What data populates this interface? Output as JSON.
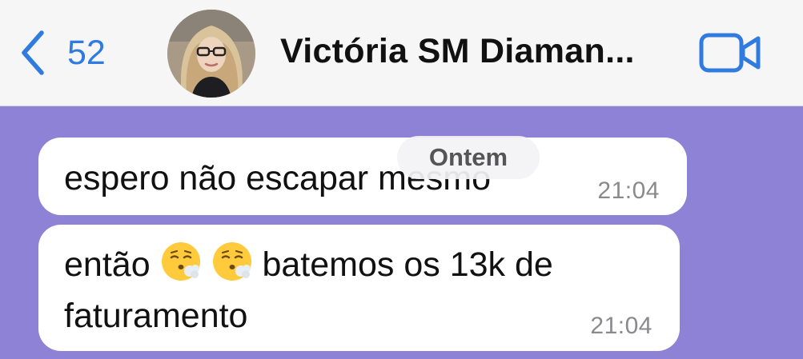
{
  "header": {
    "back_count": "52",
    "contact_name": "Victória SM Diaman...",
    "accent_color": "#2F7BE0",
    "icons": {
      "back": "chevron-left-icon",
      "video": "video-camera-icon"
    }
  },
  "date_separator": "Ontem",
  "messages": [
    {
      "text": "espero não escapar mesmo",
      "time": "21:04"
    },
    {
      "text_line1_before": "então",
      "text_line1_after": "batemos os 13k de",
      "text_line2": "faturamento",
      "emojis": [
        "face-exhaling-emoji",
        "face-exhaling-emoji"
      ],
      "time": "21:04"
    }
  ],
  "colors": {
    "chat_background": "#8E82D6",
    "bubble": "#FFFFFF",
    "header_background": "#F6F6F7"
  }
}
